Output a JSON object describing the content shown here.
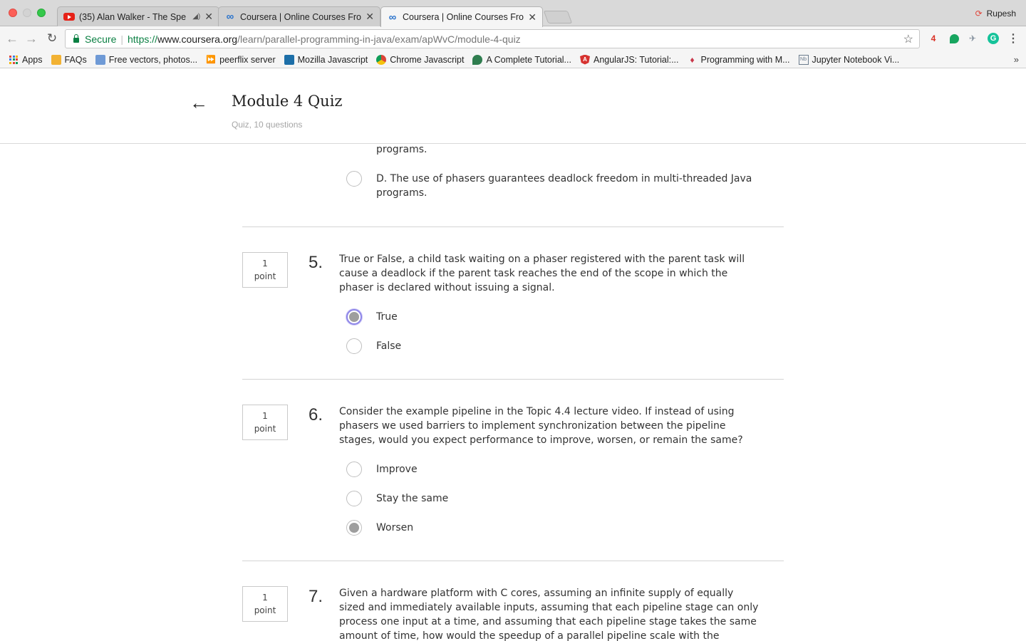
{
  "browser": {
    "tabs": [
      {
        "title": "(35) Alan Walker - The Spe",
        "icon": "youtube-icon",
        "audio": true
      },
      {
        "title": "Coursera | Online Courses Fro",
        "icon": "coursera-icon"
      },
      {
        "title": "Coursera | Online Courses Fro",
        "icon": "coursera-icon",
        "active": true
      }
    ],
    "profile_name": "Rupesh",
    "secure_label": "Secure",
    "url": {
      "scheme": "https://",
      "host": "www.coursera.org",
      "path": "/learn/parallel-programming-in-java/exam/apWvC/module-4-quiz"
    },
    "bookmarks": [
      "Apps",
      "FAQs",
      "Free vectors, photos...",
      "peerflix server",
      "Mozilla Javascript",
      "Chrome Javascript",
      "A Complete Tutorial...",
      "AngularJS: Tutorial:...",
      "Programming with M...",
      "Jupyter Notebook Vi..."
    ],
    "extension_badge": "4"
  },
  "header": {
    "title": "Module 4 Quiz",
    "subtitle": "Quiz, 10 questions"
  },
  "questions": {
    "q4": {
      "partial_option_tail": "programs.",
      "option_d": "D. The use of phasers guarantees deadlock freedom in multi-threaded Java programs."
    },
    "q5": {
      "number": "5.",
      "points_value": "1",
      "points_unit": "point",
      "text": "True or False, a child task waiting on a phaser registered with the parent task will cause a deadlock if the parent task reaches the end of the scope in which the phaser is declared without issuing a signal.",
      "options": [
        "True",
        "False"
      ],
      "selected": "True"
    },
    "q6": {
      "number": "6.",
      "points_value": "1",
      "points_unit": "point",
      "text": "Consider the example pipeline in the Topic 4.4 lecture video. If instead of using phasers we used barriers to implement synchronization between the pipeline stages, would you expect performance to improve, worsen, or remain the same?",
      "options": [
        "Improve",
        "Stay the same",
        "Worsen"
      ],
      "selected": "Worsen"
    },
    "q7": {
      "number": "7.",
      "points_value": "1",
      "points_unit": "point",
      "text": "Given a hardware platform with C cores, assuming an infinite supply of equally sized and immediately available inputs, assuming that each pipeline stage can only process one input at a time, and assuming that each pipeline stage takes the same amount of time, how would the speedup of a parallel pipeline scale with the number of pipeline stages P?"
    }
  },
  "colors": {
    "secure_green": "#0b8043",
    "radio_checked": "#9e9e9e",
    "focus_ring": "#8e86e8"
  }
}
